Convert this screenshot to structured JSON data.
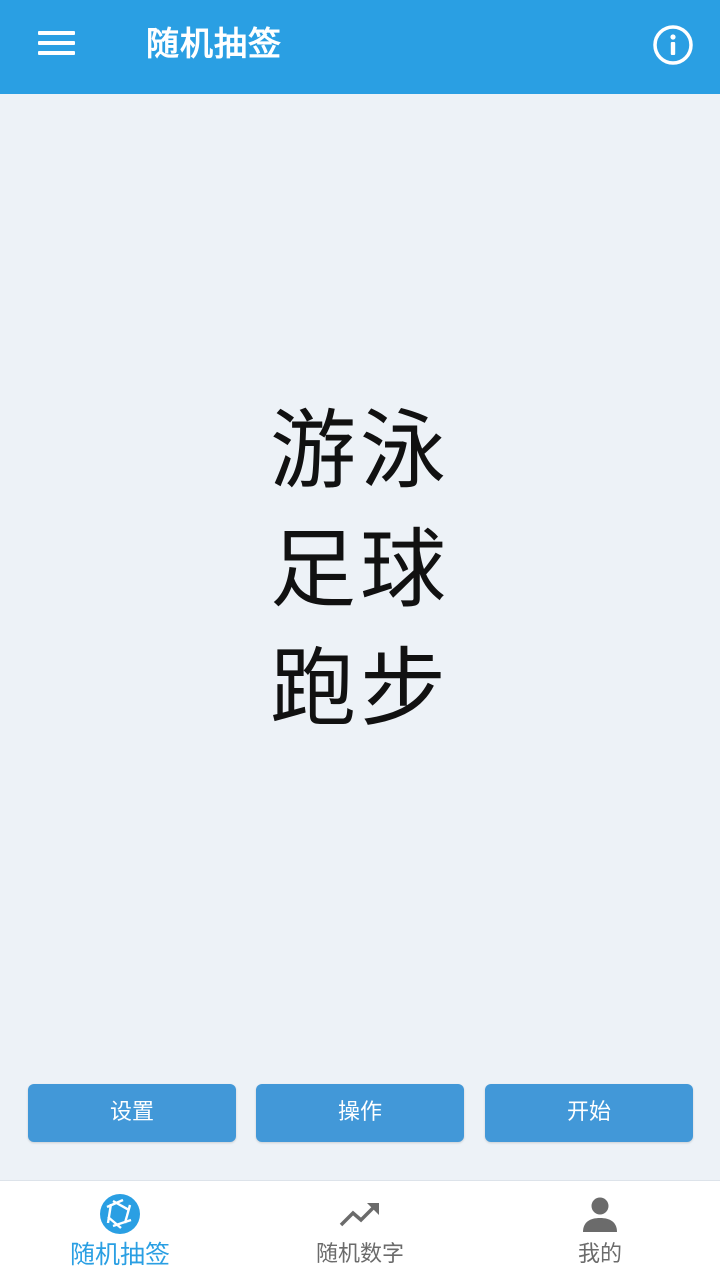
{
  "app_bar": {
    "title": "随机抽签",
    "menu_icon": "menu-icon",
    "info_icon": "info-icon"
  },
  "results": [
    "游泳",
    "足球",
    "跑步"
  ],
  "actions": [
    {
      "label": "设置"
    },
    {
      "label": "操作"
    },
    {
      "label": "开始"
    }
  ],
  "bottom_nav": {
    "items": [
      {
        "label": "随机抽签",
        "icon": "shutter-icon",
        "active": true
      },
      {
        "label": "随机数字",
        "icon": "trending-up-icon",
        "active": false
      },
      {
        "label": "我的",
        "icon": "person-icon",
        "active": false
      }
    ]
  },
  "colors": {
    "primary": "#2a9fe3",
    "button": "#4298d8",
    "background": "#edf2f7",
    "nav_inactive": "#6b6b6b"
  }
}
